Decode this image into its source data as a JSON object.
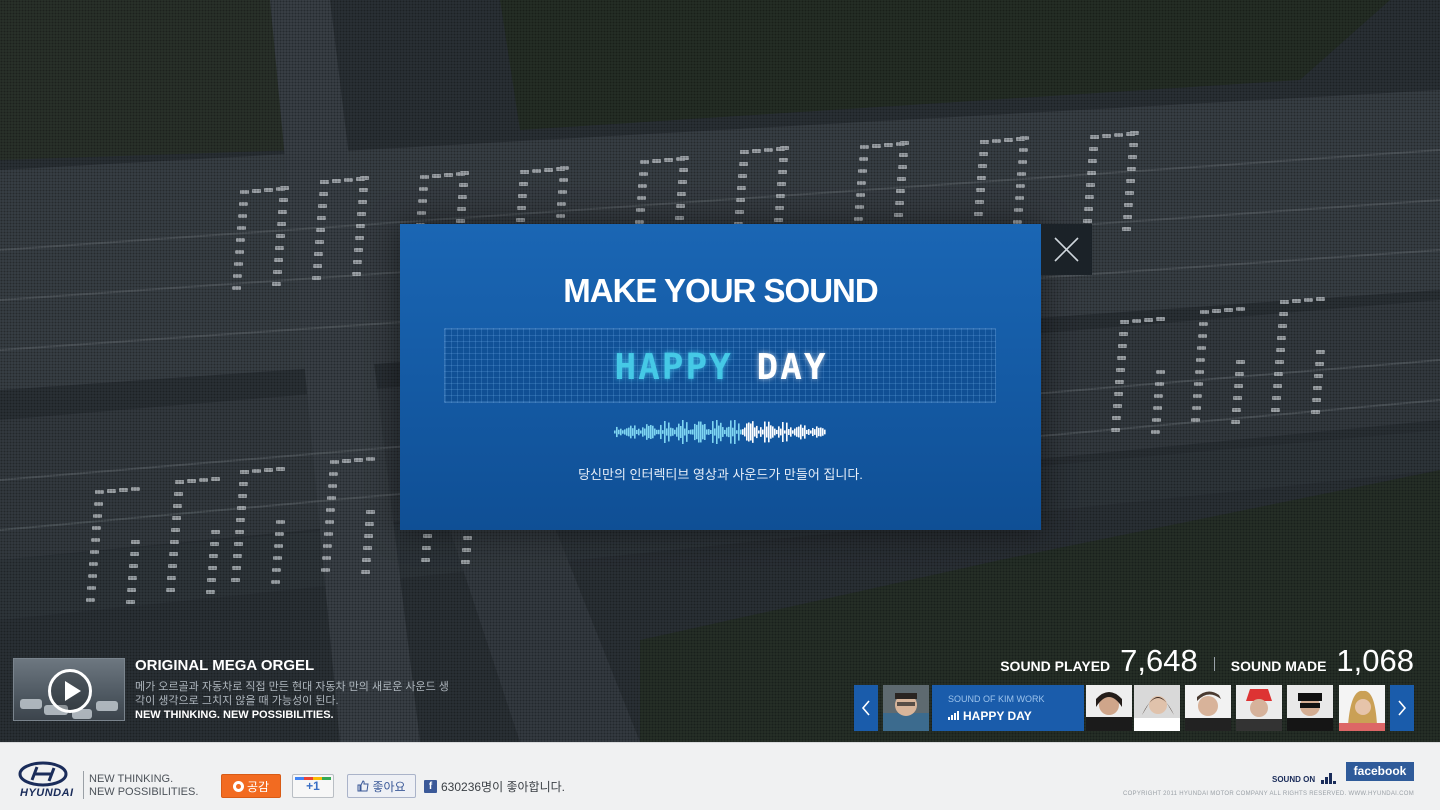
{
  "modal": {
    "title": "MAKE YOUR SOUND",
    "sound_word_1": "HAPPY",
    "sound_word_2": "DAY",
    "description": "당신만의 인터렉티브 영상과 사운드가 만들어 집니다."
  },
  "promo": {
    "title": "ORIGINAL MEGA ORGEL",
    "description": "메가 오르골과 자동차로 직접 만든 현대 자동차 만의 새로운 사운드 생각이 생각으로 그치지 않을 때 가능성이 된다.",
    "slogan": "NEW THINKING. NEW POSSIBILITIES."
  },
  "stats": {
    "played_label": "SOUND PLAYED",
    "played_value": "7,648",
    "made_label": "SOUND MADE",
    "made_value": "1,068"
  },
  "carousel": {
    "current_label": "SOUND OF KIM WORK",
    "current_title": "HAPPY DAY",
    "avatar_count_visible": 7
  },
  "footer": {
    "logo_text": "HYUNDAI",
    "slogan_line_1": "NEW THINKING.",
    "slogan_line_2": "NEW POSSIBILITIES.",
    "gonggam_label": "공감",
    "plusone_label": "+1",
    "like_label": "좋아요",
    "fb_count_text": "630236명이 좋아합니다.",
    "sound_on_label": "SOUND ON",
    "facebook_label": "facebook",
    "copyright": "COPYRIGHT 2011 HYUNDAI MOTOR COMPANY ALL RIGHTS RESERVED.   WWW.HYUNDAI.COM"
  },
  "colors": {
    "modal_blue": "#1a66b4",
    "accent_blue": "#1a5cab",
    "cyan_text": "#45c9e6",
    "footer_bg": "#f0f1f2"
  }
}
